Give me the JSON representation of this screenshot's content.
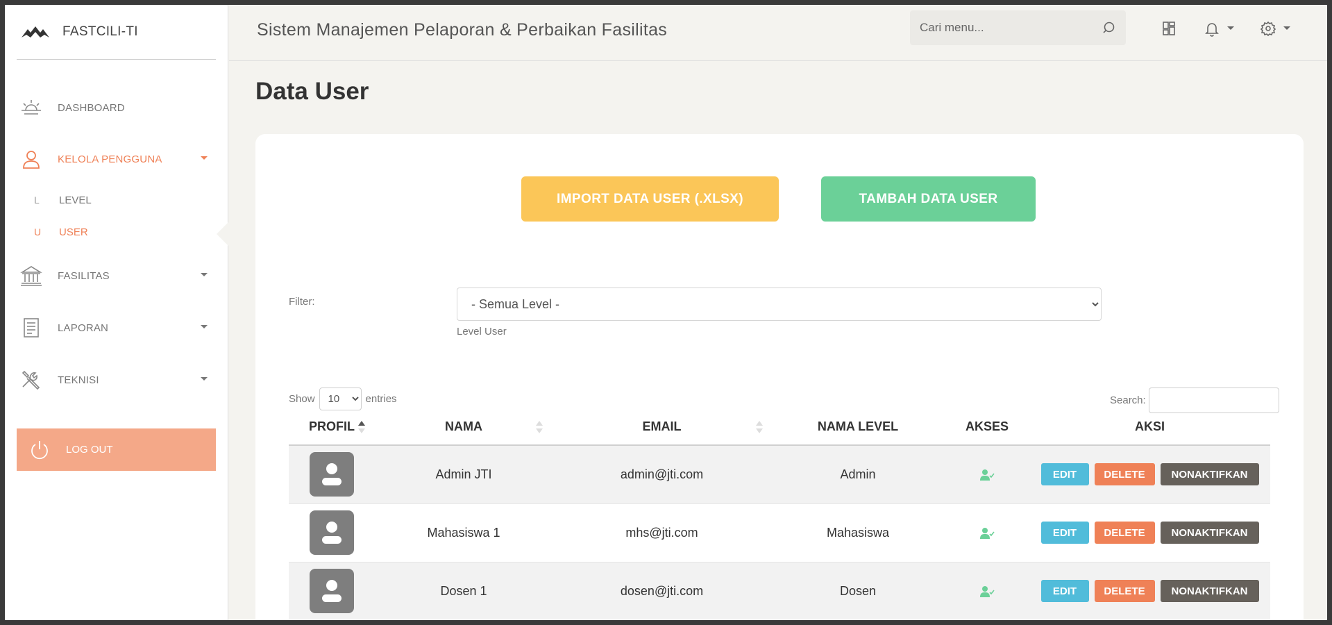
{
  "brand": {
    "name": "FASTCILI-TI"
  },
  "sidebar": {
    "items": [
      {
        "label": "DASHBOARD",
        "icon": "sunrise-icon"
      },
      {
        "label": "KELOLA PENGGUNA",
        "icon": "user-icon"
      },
      {
        "label": "FASILITAS",
        "icon": "bank-icon"
      },
      {
        "label": "LAPORAN",
        "icon": "document-icon"
      },
      {
        "label": "TEKNISI",
        "icon": "tools-icon"
      }
    ],
    "subitems": [
      {
        "mini": "L",
        "label": "LEVEL"
      },
      {
        "mini": "U",
        "label": "USER"
      }
    ],
    "logout": "LOG OUT"
  },
  "header": {
    "title": "Sistem Manajemen Pelaporan & Perbaikan Fasilitas",
    "search_placeholder": "Cari menu..."
  },
  "page": {
    "title": "Data User"
  },
  "actions": {
    "import": "IMPORT DATA USER (.XLSX)",
    "add": "TAMBAH DATA USER"
  },
  "filter": {
    "label": "Filter:",
    "selected": "- Semua Level -",
    "help": "Level User"
  },
  "datatable": {
    "show": "Show",
    "entries": "entries",
    "page_length": "10",
    "search_label": "Search:"
  },
  "table": {
    "columns": [
      "PROFIL",
      "NAMA",
      "EMAIL",
      "NAMA LEVEL",
      "AKSES",
      "AKSI"
    ],
    "rows": [
      {
        "nama": "Admin JTI",
        "email": "admin@jti.com",
        "level": "Admin"
      },
      {
        "nama": "Mahasiswa 1",
        "email": "mhs@jti.com",
        "level": "Mahasiswa"
      },
      {
        "nama": "Dosen 1",
        "email": "dosen@jti.com",
        "level": "Dosen"
      }
    ],
    "buttons": {
      "edit": "EDIT",
      "delete": "DELETE",
      "deactivate": "NONAKTIFKAN"
    }
  },
  "colors": {
    "accent": "#ef8157",
    "import": "#fbc658",
    "add": "#6bd098",
    "edit": "#51bcda",
    "dark": "#66615b",
    "access": "#6bd098"
  }
}
